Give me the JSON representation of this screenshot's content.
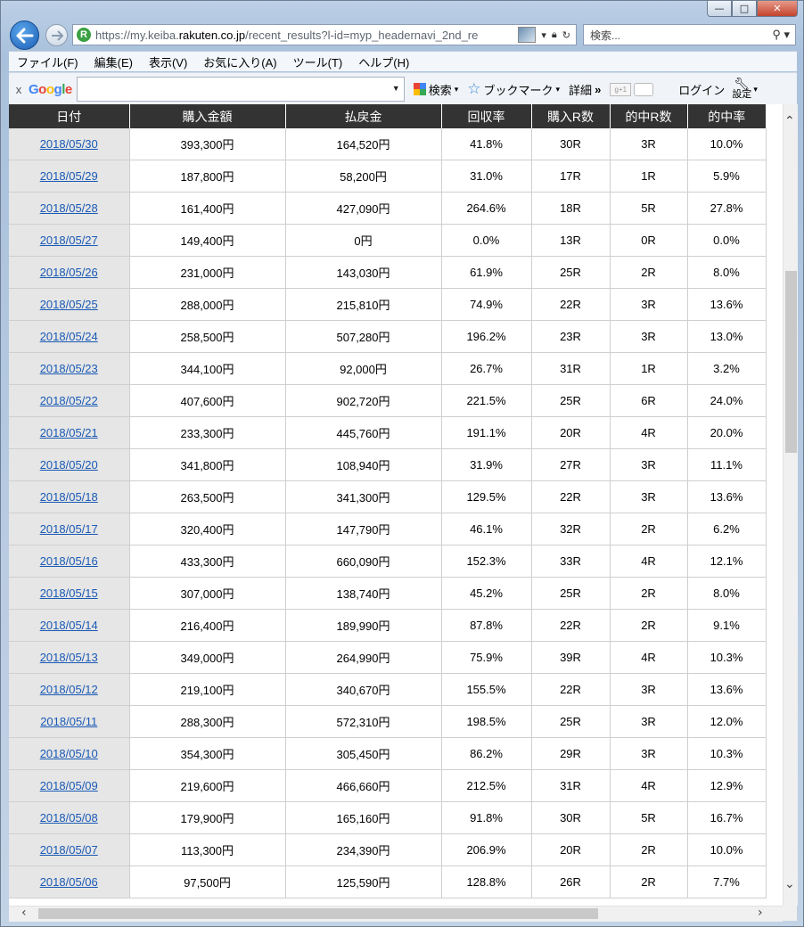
{
  "window": {
    "minimize": "—",
    "maximize": "□",
    "close": "✕"
  },
  "address": {
    "url_prefix": "https://my.keiba.",
    "url_domain": "rakuten.co.jp",
    "url_rest": "/recent_results?l-id=myp_headernavi_2nd_re",
    "site_icon_letter": "R",
    "site_icon_color": "#3aa043"
  },
  "search": {
    "placeholder": "検索..."
  },
  "menu": [
    "ファイル(F)",
    "編集(E)",
    "表示(V)",
    "お気に入り(A)",
    "ツール(T)",
    "ヘルプ(H)"
  ],
  "google_toolbar": {
    "close": "x",
    "logo": [
      "G",
      "o",
      "o",
      "g",
      "l",
      "e"
    ],
    "search_label": "検索",
    "bookmark_label": "ブックマーク",
    "detail_label": "詳細",
    "more": "»",
    "plus_label": "g+1",
    "login_label": "ログイン",
    "settings_label": "設定"
  },
  "table": {
    "headers": [
      "日付",
      "購入金額",
      "払戻金",
      "回収率",
      "購入R数",
      "的中R数",
      "的中率"
    ],
    "rows": [
      [
        "2018/05/30",
        "393,300円",
        "164,520円",
        "41.8%",
        "30R",
        "3R",
        "10.0%"
      ],
      [
        "2018/05/29",
        "187,800円",
        "58,200円",
        "31.0%",
        "17R",
        "1R",
        "5.9%"
      ],
      [
        "2018/05/28",
        "161,400円",
        "427,090円",
        "264.6%",
        "18R",
        "5R",
        "27.8%"
      ],
      [
        "2018/05/27",
        "149,400円",
        "0円",
        "0.0%",
        "13R",
        "0R",
        "0.0%"
      ],
      [
        "2018/05/26",
        "231,000円",
        "143,030円",
        "61.9%",
        "25R",
        "2R",
        "8.0%"
      ],
      [
        "2018/05/25",
        "288,000円",
        "215,810円",
        "74.9%",
        "22R",
        "3R",
        "13.6%"
      ],
      [
        "2018/05/24",
        "258,500円",
        "507,280円",
        "196.2%",
        "23R",
        "3R",
        "13.0%"
      ],
      [
        "2018/05/23",
        "344,100円",
        "92,000円",
        "26.7%",
        "31R",
        "1R",
        "3.2%"
      ],
      [
        "2018/05/22",
        "407,600円",
        "902,720円",
        "221.5%",
        "25R",
        "6R",
        "24.0%"
      ],
      [
        "2018/05/21",
        "233,300円",
        "445,760円",
        "191.1%",
        "20R",
        "4R",
        "20.0%"
      ],
      [
        "2018/05/20",
        "341,800円",
        "108,940円",
        "31.9%",
        "27R",
        "3R",
        "11.1%"
      ],
      [
        "2018/05/18",
        "263,500円",
        "341,300円",
        "129.5%",
        "22R",
        "3R",
        "13.6%"
      ],
      [
        "2018/05/17",
        "320,400円",
        "147,790円",
        "46.1%",
        "32R",
        "2R",
        "6.2%"
      ],
      [
        "2018/05/16",
        "433,300円",
        "660,090円",
        "152.3%",
        "33R",
        "4R",
        "12.1%"
      ],
      [
        "2018/05/15",
        "307,000円",
        "138,740円",
        "45.2%",
        "25R",
        "2R",
        "8.0%"
      ],
      [
        "2018/05/14",
        "216,400円",
        "189,990円",
        "87.8%",
        "22R",
        "2R",
        "9.1%"
      ],
      [
        "2018/05/13",
        "349,000円",
        "264,990円",
        "75.9%",
        "39R",
        "4R",
        "10.3%"
      ],
      [
        "2018/05/12",
        "219,100円",
        "340,670円",
        "155.5%",
        "22R",
        "3R",
        "13.6%"
      ],
      [
        "2018/05/11",
        "288,300円",
        "572,310円",
        "198.5%",
        "25R",
        "3R",
        "12.0%"
      ],
      [
        "2018/05/10",
        "354,300円",
        "305,450円",
        "86.2%",
        "29R",
        "3R",
        "10.3%"
      ],
      [
        "2018/05/09",
        "219,600円",
        "466,660円",
        "212.5%",
        "31R",
        "4R",
        "12.9%"
      ],
      [
        "2018/05/08",
        "179,900円",
        "165,160円",
        "91.8%",
        "30R",
        "5R",
        "16.7%"
      ],
      [
        "2018/05/07",
        "113,300円",
        "234,390円",
        "206.9%",
        "20R",
        "2R",
        "10.0%"
      ],
      [
        "2018/05/06",
        "97,500円",
        "125,590円",
        "128.8%",
        "26R",
        "2R",
        "7.7%"
      ]
    ]
  }
}
